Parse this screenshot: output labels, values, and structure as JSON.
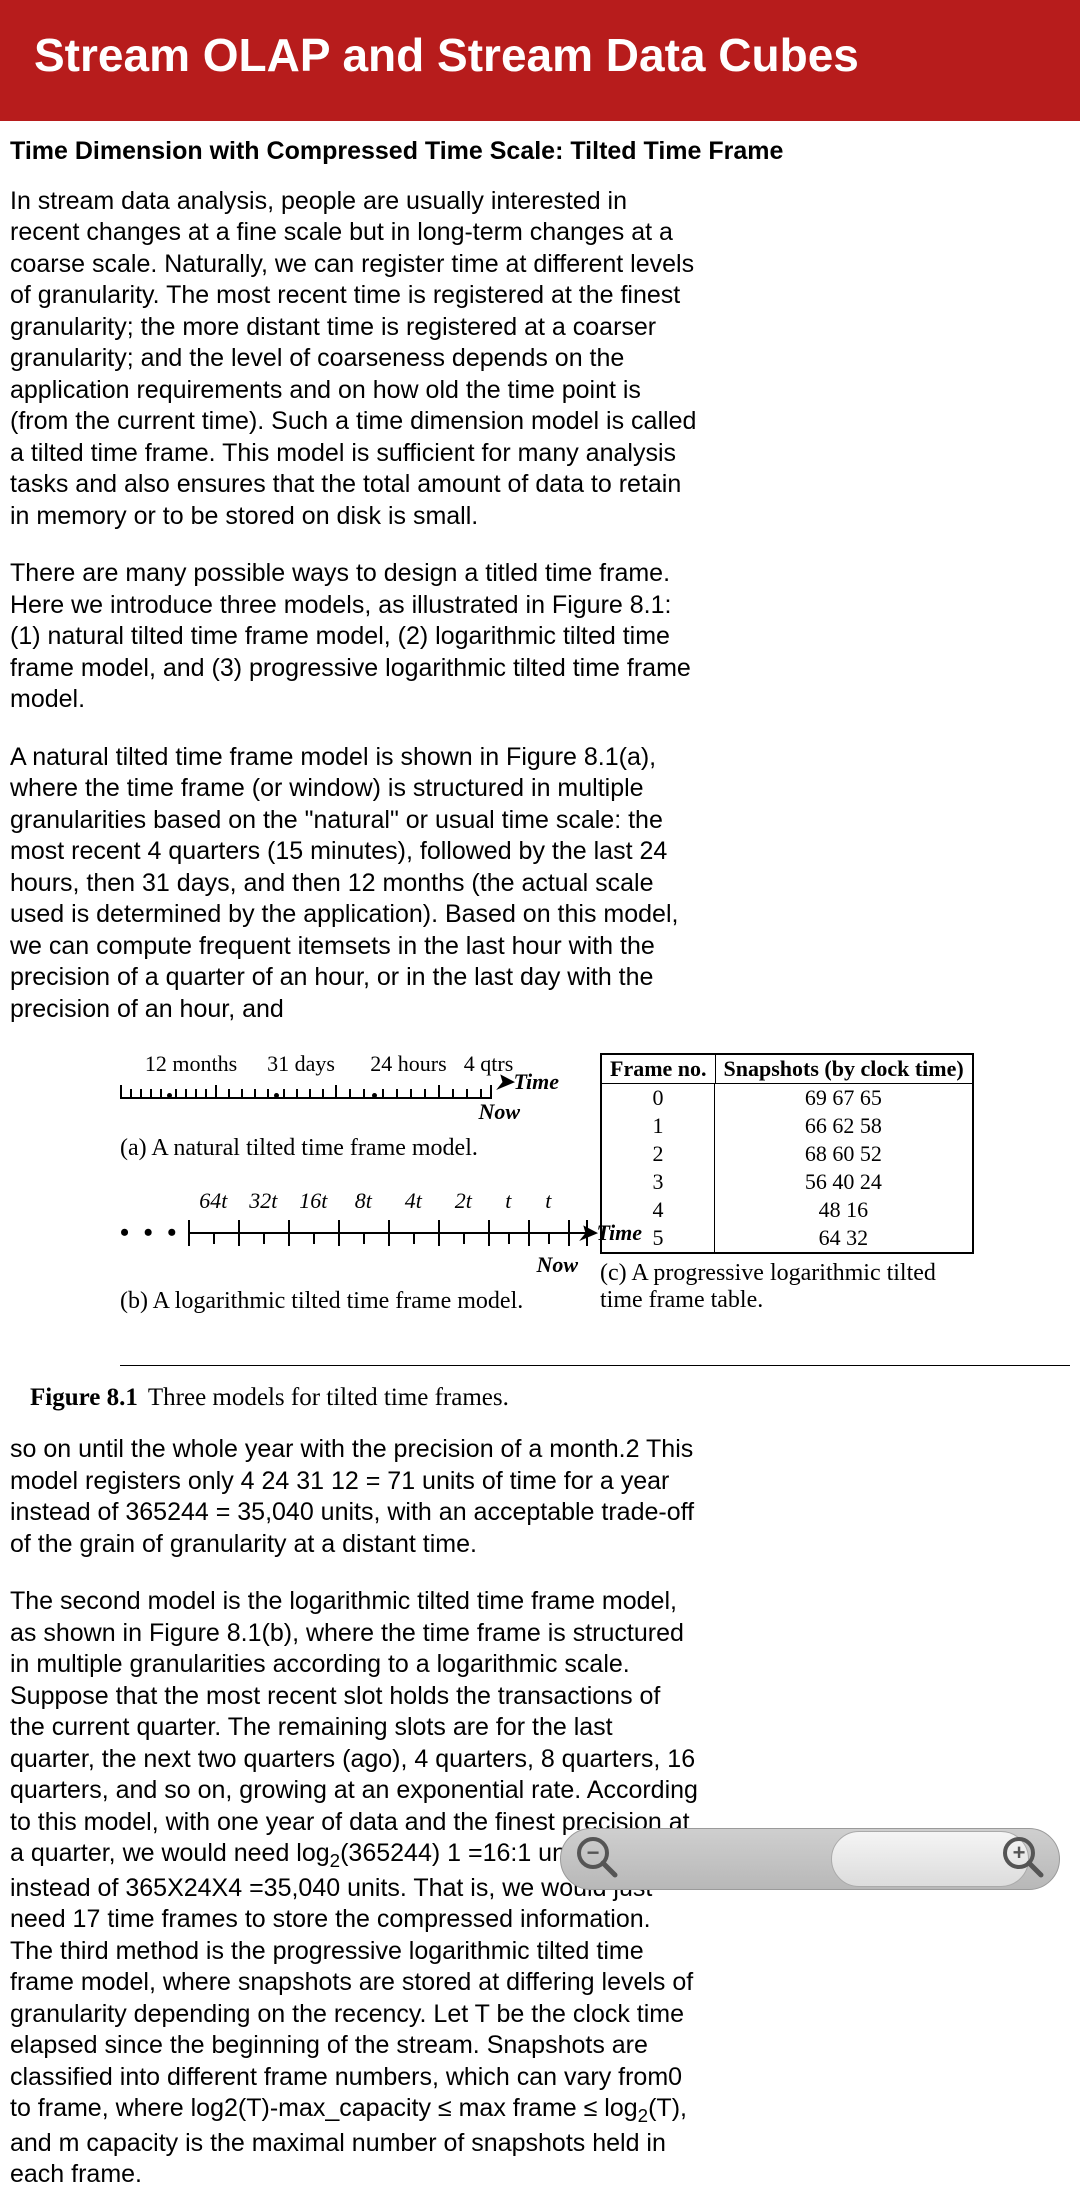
{
  "header": {
    "title": "Stream OLAP and Stream Data Cubes"
  },
  "section_head": "Time Dimension with Compressed Time Scale: Tilted Time Frame",
  "paragraphs": {
    "p1": "In stream data analysis, people are usually interested in recent changes at a fine scale but in long-term changes at a coarse scale. Naturally, we can register time at different levels of granularity. The most recent time is registered at the finest granularity; the more distant time is registered at a coarser granularity; and the level of coarseness depends on the application requirements and on how old the time point is (from the current time). Such a time dimension model is called a tilted time frame. This model is sufficient for many analysis tasks and also ensures that the total amount of data to retain in memory or to be stored on disk is small.",
    "p2": "There are many possible ways to design a titled time frame. Here we introduce three models, as illustrated in Figure 8.1: (1) natural tilted time frame model, (2) logarithmic tilted time frame model, and (3) progressive logarithmic tilted time frame model.",
    "p3": "A natural tilted time frame model is shown in Figure 8.1(a), where the time frame (or window) is structured in multiple granularities based on the \"natural\" or usual time scale: the most recent 4 quarters (15 minutes), followed by the last 24 hours, then 31 days, and then 12 months (the actual scale used is determined by the application). Based on this model, we can compute frequent itemsets in the last hour with the precision of a quarter of an hour, or in the last day with the precision of an hour, and",
    "p4": "so on until the whole year with the precision of a month.2 This model registers only 4 24 31 12 = 71 units of time for a year instead of 365244 = 35,040 units, with an acceptable trade-off of the grain of granularity at a distant time.",
    "p5a": "The second model is the logarithmic tilted time frame model, as shown in Figure 8.1(b), where the time frame is structured in multiple granularities according to a logarithmic scale. Suppose that the most recent slot holds the transactions of the current quarter. The remaining slots are for the last quarter, the next two quarters (ago), 4 quarters, 8 quarters, 16 quarters, and so on, growing at an exponential rate. According to this model, with one year of data and the finest precision at a quarter, we would need log",
    "p5b": "(365244) 1 =16:1 units of time instead of 365X24X4 =35,040 units. That is, we would just need 17 time frames to store the compressed information. The third method is the progressive logarithmic tilted time frame model, where snapshots are stored at differing levels of granularity depending on the recency. Let T be the clock time elapsed since the beginning of the stream. Snapshots are  classified into different frame numbers, which can vary from0 to           frame, where log2(T)-max_capacity ≤ max frame ≤ log",
    "p5c": "(T), and m     capacity is the maximal number of snapshots held in each frame.",
    "sub2a": "2",
    "sub2b": "2"
  },
  "figure": {
    "a_labels": {
      "l1": "12 months",
      "l2": "31 days",
      "l3": "24 hours",
      "l4": "4 qtrs"
    },
    "time_label": "Time",
    "now_label": "Now",
    "caption_a": "(a) A natural tilted time frame model.",
    "b_labels": {
      "l1": "64t",
      "l2": "32t",
      "l3": "16t",
      "l4": "8t",
      "l5": "4t",
      "l6": "2t",
      "l7": "t",
      "l8": "t"
    },
    "caption_b": "(b) A logarithmic tilted time frame model.",
    "caption_c": "(c) A progressive logarithmic tilted time frame table.",
    "table": {
      "h1": "Frame no.",
      "h2": "Snapshots (by clock time)",
      "rows": [
        {
          "n": "0",
          "s": "69 67 65"
        },
        {
          "n": "1",
          "s": "66 62 58"
        },
        {
          "n": "2",
          "s": "68 60 52"
        },
        {
          "n": "3",
          "s": "56 40 24"
        },
        {
          "n": "4",
          "s": "48 16"
        },
        {
          "n": "5",
          "s": "64 32"
        }
      ]
    },
    "fig_num": "Figure 8.1",
    "fig_title": "Three models for tilted time frames."
  },
  "zoom": {
    "minus": "−",
    "plus": "+"
  }
}
